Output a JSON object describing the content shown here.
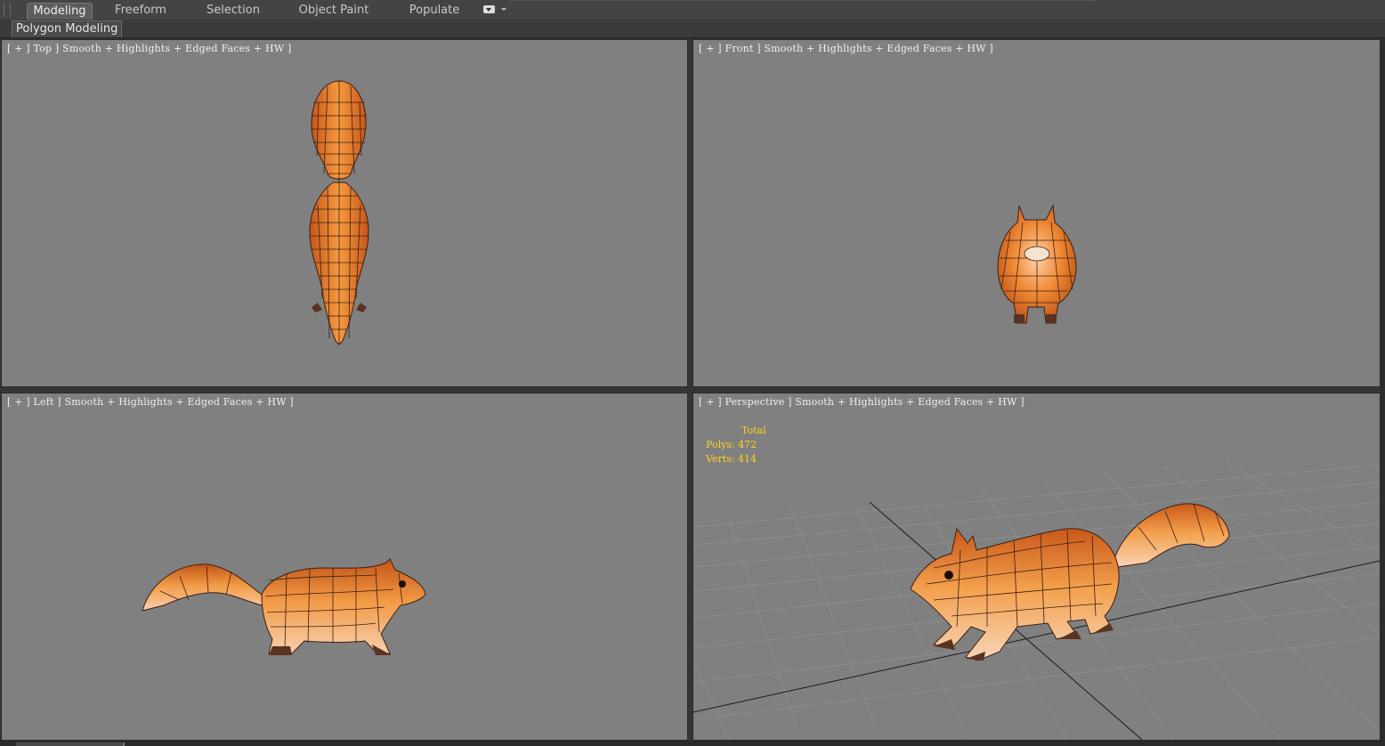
{
  "ribbon": {
    "tabs": [
      {
        "label": "Modeling",
        "active": true
      },
      {
        "label": "Freeform",
        "active": false
      },
      {
        "label": "Selection",
        "active": false
      },
      {
        "label": "Object Paint",
        "active": false
      },
      {
        "label": "Populate",
        "active": false
      }
    ]
  },
  "subbar": {
    "panel_label": "Polygon Modeling"
  },
  "viewports": {
    "top": {
      "label": "[ + ] Top ] Smooth + Highlights + Edged Faces + HW ]"
    },
    "front": {
      "label": "[ + ] Front ] Smooth + Highlights + Edged Faces + HW ]"
    },
    "left": {
      "label": "[ + ] Left ] Smooth + Highlights + Edged Faces + HW ]"
    },
    "persp": {
      "label": "[ + ] Perspective ] Smooth + Highlights + Edged Faces + HW ]",
      "stats": {
        "header": "Total",
        "polys": "Polys: 472",
        "verts": "Verts: 414"
      }
    }
  },
  "colors": {
    "viewport_bg": "#808080",
    "model_orange": "#e87d2a",
    "wire": "#3a1f14",
    "stats_yellow": "#ffd21a"
  }
}
